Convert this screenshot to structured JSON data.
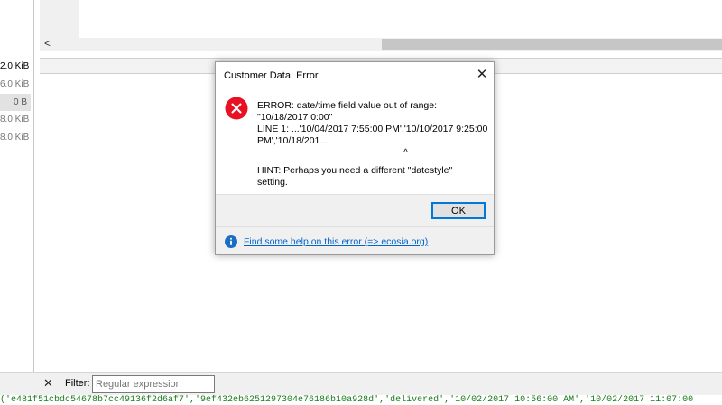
{
  "left_sizes": [
    "2.0 KiB",
    "6.0 KiB",
    "0 B",
    "8.0 KiB",
    "8.0 KiB"
  ],
  "hscroll": {
    "left_arrow": "<"
  },
  "filter": {
    "close_glyph": "✕",
    "label": "Filter:",
    "placeholder": "Regular expression"
  },
  "sql_line": "('e481f51cbdc54678b7cc49136f2d6af7','9ef432eb6251297304e76186b10a928d','delivered','10/02/2017  10:56:00 AM','10/02/2017  11:07:00",
  "dialog": {
    "title": "Customer Data: Error",
    "close_glyph": "✕",
    "message_lines": [
      "ERROR:  date/time field value out of range:",
      "\"10/18/2017 0:00\"",
      "LINE 1: ...'10/04/2017  7:55:00 PM','10/10/2017  9:25:00",
      "PM','10/18/201...",
      "^",
      "HINT:  Perhaps you need a different \"datestyle\"",
      "setting."
    ],
    "ok_label": "OK",
    "help_link": "Find some help on this error (=> ecosia.org)"
  },
  "colors": {
    "error_red": "#e81123",
    "info_blue": "#1a6fc4",
    "link_blue": "#0066cc",
    "sql_green": "#1a7a1a",
    "focus_blue": "#0078d7"
  },
  "icons": [
    "error-icon",
    "info-icon",
    "close-icon"
  ]
}
